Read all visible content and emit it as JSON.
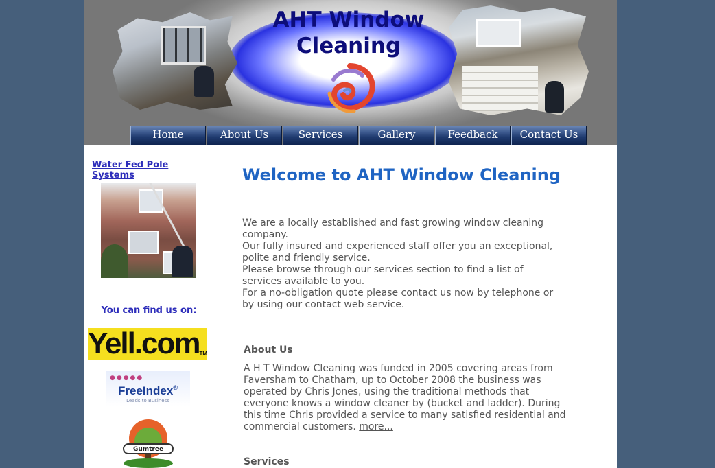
{
  "header": {
    "title_line1": "AHT Window",
    "title_line2": "Cleaning"
  },
  "nav": {
    "items": [
      "Home",
      "About Us",
      "Services",
      "Gallery",
      "Feedback",
      "Contact Us"
    ]
  },
  "sidebar": {
    "link": "Water Fed Pole Systems",
    "find_us": "You can find us on:",
    "yell": "Yell.com",
    "yell_tm": "TM",
    "freeindex": "FreeIndex",
    "freeindex_reg": "®",
    "freeindex_sub": "Leads to Business",
    "gumtree": "Gumtree"
  },
  "main": {
    "heading": "Welcome to AHT Window Cleaning",
    "intro": [
      "We are a locally established and fast growing window cleaning company.",
      "Our fully insured and experienced staff offer you an exceptional, polite and friendly service.",
      "Please browse through our services section to find a list of services available to you.",
      "For a no-obligation quote please contact us now by telephone or by using our contact web service."
    ],
    "about_heading": "About Us",
    "about_text": "A H T Window Cleaning was funded in 2005 covering areas from Faversham to Chatham, up to October 2008 the business was operated by Chris Jones, using the traditional methods that everyone knows a window cleaner by (bucket and ladder). During this time Chris provided a service to many satisfied residential and commercial customers.",
    "more_link": "more...",
    "services_heading": "Services"
  },
  "colors": {
    "background": "#465f7b",
    "heading_blue": "#1f64c3",
    "title_navy": "#0d0d7a",
    "link_blue": "#2d2dba",
    "body_text": "#555555",
    "yell_yellow": "#f5df1f"
  }
}
